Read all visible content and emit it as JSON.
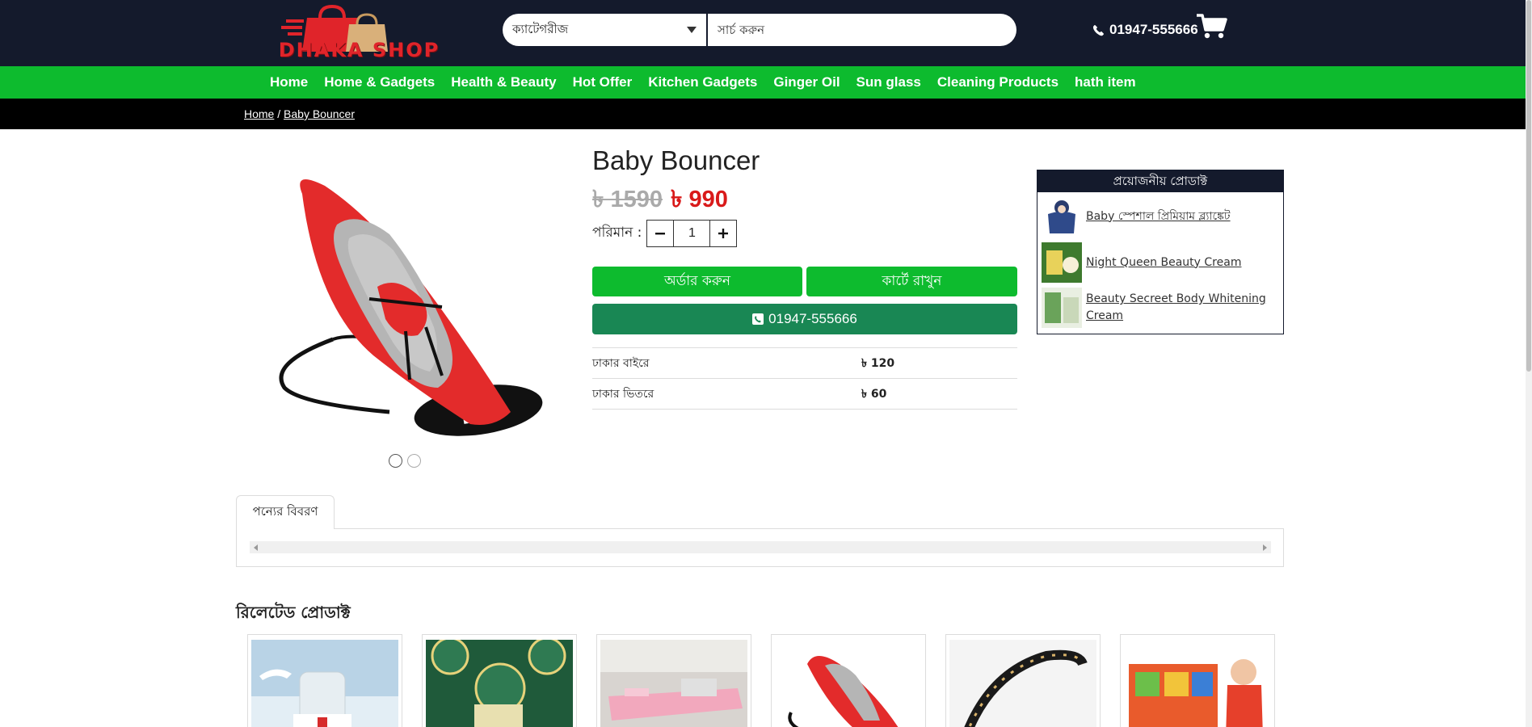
{
  "brand": {
    "name": "DHAKA SHOP"
  },
  "header": {
    "category_label": "ক্যাটেগরীজ",
    "search_placeholder": "সার্চ করুন",
    "phone": "01947-555666"
  },
  "nav": {
    "items": [
      {
        "label": "Home"
      },
      {
        "label": "Home & Gadgets"
      },
      {
        "label": "Health & Beauty"
      },
      {
        "label": "Hot Offer"
      },
      {
        "label": "Kitchen Gadgets"
      },
      {
        "label": "Ginger Oil"
      },
      {
        "label": "Sun glass"
      },
      {
        "label": "Cleaning Products"
      },
      {
        "label": "hath item"
      }
    ]
  },
  "breadcrumb": {
    "home": "Home",
    "separator": "/",
    "current": "Baby Bouncer"
  },
  "product": {
    "title": "Baby Bouncer",
    "old_price": "৳ 1590",
    "new_price": "৳ 990",
    "quantity_label": "পরিমান :",
    "quantity": "1",
    "order_button": "অর্ডার করুন",
    "cart_button": "কার্টে রাখুন",
    "call_button": "01947-555666",
    "shipping": [
      {
        "label": "ঢাকার বাইরে",
        "value": "৳ 120"
      },
      {
        "label": "ঢাকার ভিতরে",
        "value": "৳ 60"
      }
    ],
    "gallery": {
      "slides": 2,
      "active_slide": 1
    }
  },
  "sidebox": {
    "title": "প্রয়োজনীয় প্রোডাক্ট",
    "items": [
      {
        "label": "Baby স্পেশাল প্রিমিয়াম ব্ল্যাঙ্কেট"
      },
      {
        "label": "Night Queen Beauty Cream"
      },
      {
        "label": "Beauty Secreet Body Whitening Cream"
      }
    ]
  },
  "tabs": {
    "description": "পন্যের বিবরণ"
  },
  "related": {
    "title": "রিলেটেড প্রোডাক্ট"
  },
  "colors": {
    "navy": "#141a2c",
    "green": "#0dbb2e",
    "dark_green": "#198754",
    "red_price": "#d91a1a"
  }
}
